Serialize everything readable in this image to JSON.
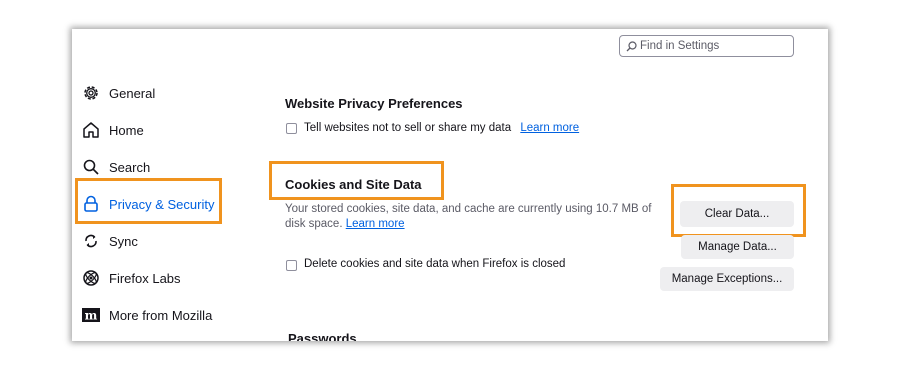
{
  "search": {
    "placeholder": "Find in Settings"
  },
  "sidebar": {
    "items": [
      {
        "label": "General",
        "icon": "gear-icon"
      },
      {
        "label": "Home",
        "icon": "home-icon"
      },
      {
        "label": "Search",
        "icon": "search-icon"
      },
      {
        "label": "Privacy & Security",
        "icon": "lock-icon",
        "selected": true
      },
      {
        "label": "Sync",
        "icon": "sync-icon"
      },
      {
        "label": "Firefox Labs",
        "icon": "flask-icon"
      },
      {
        "label": "More from Mozilla",
        "icon": "mozilla-m-icon"
      }
    ]
  },
  "main": {
    "website_privacy": {
      "heading": "Website Privacy Preferences",
      "checkbox_label": "Tell websites not to sell or share my data",
      "learn_more": "Learn more"
    },
    "cookies": {
      "heading": "Cookies and Site Data",
      "description_line1": "Your stored cookies, site data, and cache are currently using 10.7 MB of",
      "description_line2": "disk space.",
      "learn_more": "Learn more",
      "delete_checkbox_label": "Delete cookies and site data when Firefox is closed",
      "clear_data_button": "Clear Data...",
      "manage_data_button": "Manage Data...",
      "manage_exceptions_button": "Manage Exceptions..."
    },
    "passwords": {
      "heading": "Passwords"
    }
  },
  "colors": {
    "accent": "#0061e0",
    "highlight": "#f0931e",
    "button_bg": "#eeeef0"
  }
}
